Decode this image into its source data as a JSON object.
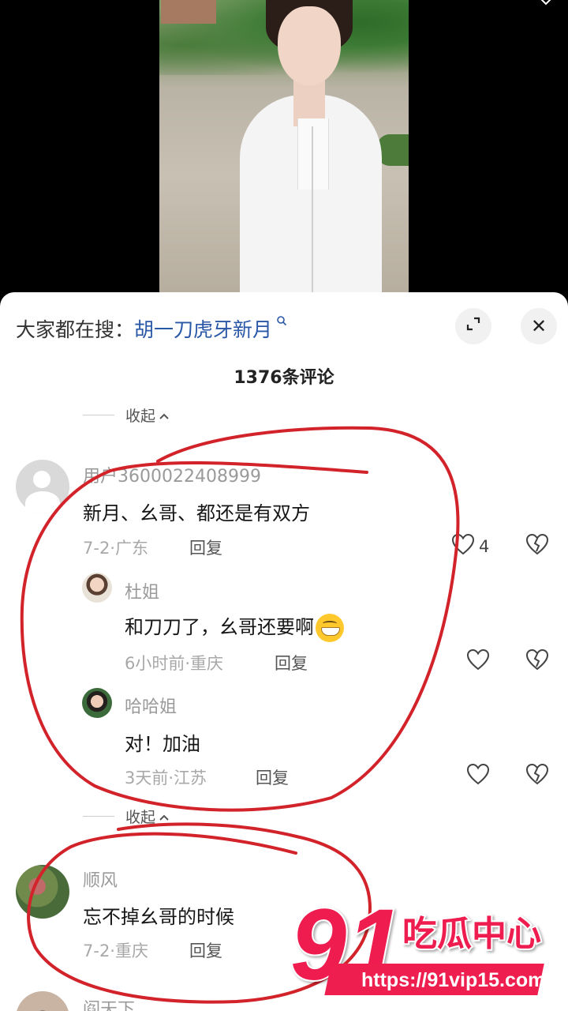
{
  "video": {
    "corner_icon": "chevron-icon"
  },
  "header": {
    "search_prefix": "大家都在搜：",
    "search_keyword": "胡一刀虎牙新月",
    "search_icon": "search-icon",
    "expand_icon": "expand-icon",
    "close_glyph": "✕"
  },
  "comments_count": "1376条评论",
  "collapse_label": "收起",
  "comments": [
    {
      "user": "用户3600022408999",
      "text": "新月、幺哥、都还是有双方",
      "meta": "7-2·广东",
      "reply": "回复",
      "likes": "4",
      "replies": [
        {
          "user": "杜姐",
          "text": "和刀刀了，幺哥还要啊",
          "emoji": "grin-emoji",
          "meta": "6小时前·重庆",
          "reply": "回复"
        },
        {
          "user": "哈哈姐",
          "text": "对！加油",
          "meta": "3天前·江苏",
          "reply": "回复"
        }
      ]
    },
    {
      "user": "顺风",
      "text": "忘不掉幺哥的时候",
      "meta": "7-2·重庆",
      "reply": "回复"
    },
    {
      "user": "阎天下"
    }
  ],
  "watermark": {
    "number": "91",
    "brand": "吃瓜中心",
    "url": "https://91vip15.com"
  },
  "colors": {
    "keyword": "#2a58a6",
    "annotation": "#d2232a",
    "watermark": "#ee1f4f"
  }
}
